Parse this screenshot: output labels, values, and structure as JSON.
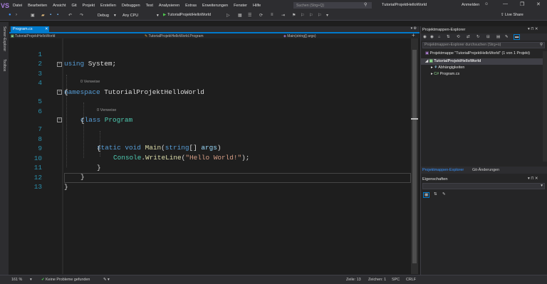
{
  "menubar": {
    "logo": "VS",
    "items": [
      "Datei",
      "Bearbeiten",
      "Ansicht",
      "Git",
      "Projekt",
      "Erstellen",
      "Debuggen",
      "Test",
      "Analysieren",
      "Extras",
      "Erweiterungen",
      "Fenster",
      "Hilfe"
    ],
    "search_placeholder": "Suchen (Strg+Q)",
    "solution_title": "TutorialProjektHelloWorld",
    "signin": "Anmelden",
    "win_min": "—",
    "win_max": "❐",
    "win_close": "✕"
  },
  "toolbar": {
    "config": "Debug",
    "platform": "Any CPU",
    "start_label": "TutorialProjektHelloWorld",
    "liveshare": "Live Share"
  },
  "left_strip": {
    "server_explorer": "Server-Explorer",
    "toolbox": "Toolbox"
  },
  "editor": {
    "tab_label": "Program.cs",
    "tab_close": "✕",
    "nav_project": "TutorialProjektHelloWorld",
    "nav_class": "TutorialProjektHelloWorld.Program",
    "nav_member": "Main(string[] args)",
    "refs_class": "0 Verweise",
    "refs_main": "0 Verweise",
    "line_numbers": [
      "1",
      "2",
      "3",
      "4",
      "5",
      "6",
      "7",
      "8",
      "9",
      "10",
      "11",
      "12",
      "13"
    ],
    "code": {
      "l1_kw": "using",
      "l1_rest": " System;",
      "l3_kw": "namespace",
      "l3_rest": " TutorialProjektHelloWorld",
      "l4": "{",
      "l5_kw": "class",
      "l5_type": "Program",
      "l6": "{",
      "l7_kw1": "static",
      "l7_kw2": "void",
      "l7_fn": "Main",
      "l7_p1": "(",
      "l7_kw3": "string",
      "l7_p2": "[] ",
      "l7_param": "args",
      "l7_p3": ")",
      "l8": "{",
      "l9_type": "Console",
      "l9_dot": ".",
      "l9_fn": "WriteLine",
      "l9_open": "(",
      "l9_str": "\"Hello World!\"",
      "l9_close": ");",
      "l10": "}",
      "l11": "}",
      "l12": "}"
    }
  },
  "statusbar": {
    "zoom": "161 %",
    "problems": "Keine Probleme gefunden",
    "line": "Zeile: 13",
    "col": "Zeichen: 1",
    "spc": "SPC",
    "crlf": "CRLF"
  },
  "solution_explorer": {
    "title": "Projektmappen-Explorer",
    "search_placeholder": "Projektmappen-Explorer durchsuchen (Strg+ü)",
    "solution_node": "Projektmappe \"TutorialProjektHelloWorld\" (1 von 1 Projekt)",
    "project_node": "TutorialProjektHelloWorld",
    "deps_node": "Abhängigkeiten",
    "file_node": "Program.cs",
    "tab_active": "Projektmappen-Explorer",
    "tab_git": "Git-Änderungen"
  },
  "properties": {
    "title": "Eigenschaften"
  },
  "colors": {
    "accent": "#007acc",
    "keyword": "#569cd6",
    "type": "#4ec9b0",
    "string": "#d69d85",
    "line_number": "#2b91af"
  }
}
